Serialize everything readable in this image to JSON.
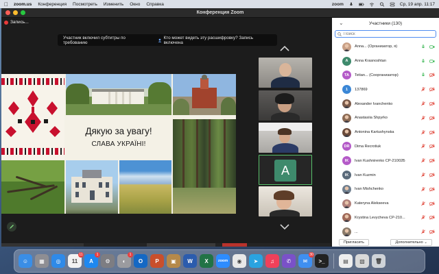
{
  "menubar": {
    "app_name": "zoom.us",
    "menus": [
      "Конференция",
      "Посмотреть",
      "Изменить",
      "Окно",
      "Справка"
    ],
    "status_app": "zoom",
    "datetime": "Ср, 19 апр. 11:17"
  },
  "window": {
    "title": "Конференция Zoom",
    "recording_label": "Запись...",
    "notice_text": "Участник включил субтитры по требованию",
    "notice_link": "Кто может видеть эту расшифровку? Запись включена"
  },
  "slide": {
    "line1": "Дякую за увагу!",
    "line2": "СЛАВА УКРАЇНІ!"
  },
  "video_tiles": [
    {
      "kind": "person"
    },
    {
      "kind": "person"
    },
    {
      "kind": "person"
    },
    {
      "kind": "avatar",
      "letter": "A",
      "color": "#3e8a6c",
      "active": true
    },
    {
      "kind": "person"
    }
  ],
  "participants": {
    "header": "Участники (130)",
    "search_placeholder": "Поиск",
    "rows": [
      {
        "name": "Anna... (Организатор, я)",
        "initials": "",
        "color": "#c9a086",
        "photo": true,
        "mic": "on",
        "video": "on"
      },
      {
        "name": "Anna Krasnoshtan",
        "initials": "A",
        "color": "#3e8a6c",
        "photo": false,
        "mic": "on",
        "video": "on"
      },
      {
        "name": "Tetian... (Соорганизатор)",
        "initials": "TA",
        "color": "#b45ac8",
        "photo": false,
        "mic": "on",
        "video": "off"
      },
      {
        "name": "137869",
        "initials": "1",
        "color": "#3b87d6",
        "photo": false,
        "mic": "off",
        "video": "off"
      },
      {
        "name": "Alexander Ivanchenko",
        "initials": "",
        "color": "#7a5a4a",
        "photo": true,
        "mic": "off",
        "video": "off"
      },
      {
        "name": "Anastasiia Shpyrko",
        "initials": "",
        "color": "#8c6b55",
        "photo": true,
        "mic": "off",
        "video": "off"
      },
      {
        "name": "Antonina Kartushynska",
        "initials": "",
        "color": "#6a4a3a",
        "photo": true,
        "mic": "off",
        "video": "off"
      },
      {
        "name": "Dima Recrotiuk",
        "initials": "DR",
        "color": "#b45ac8",
        "photo": false,
        "mic": "off",
        "video": "off"
      },
      {
        "name": "Ivan Kushnirenko CP-21002Б",
        "initials": "IK",
        "color": "#b45ac8",
        "photo": false,
        "mic": "off",
        "video": "off"
      },
      {
        "name": "Ivan Kuzmin",
        "initials": "IK",
        "color": "#5a6a7a",
        "photo": false,
        "mic": "off",
        "video": "off"
      },
      {
        "name": "Ivan Mishchenko",
        "initials": "",
        "color": "#6f7f8f",
        "photo": true,
        "mic": "off",
        "video": "off"
      },
      {
        "name": "Kateryna Alekseeva",
        "initials": "",
        "color": "#b0807a",
        "photo": true,
        "mic": "off",
        "video": "off"
      },
      {
        "name": "Krystina Levycheva CP-210...",
        "initials": "",
        "color": "#a06a5a",
        "photo": true,
        "mic": "off",
        "video": "off"
      },
      {
        "name": "...",
        "initials": "",
        "color": "#8a7a6a",
        "photo": true,
        "mic": "off",
        "video": "off"
      }
    ],
    "invite_label": "Пригласить",
    "more_label": "Дополнительно"
  },
  "dock": {
    "apps": [
      {
        "name": "finder",
        "color": "#3a8ee6",
        "glyph": "☺",
        "badge": ""
      },
      {
        "name": "launchpad",
        "color": "#8e8e93",
        "glyph": "▦",
        "badge": ""
      },
      {
        "name": "safari",
        "color": "#2f8ae8",
        "glyph": "◎",
        "badge": ""
      },
      {
        "name": "calendar",
        "color": "#f2f2f2",
        "glyph": "11",
        "badge": "11"
      },
      {
        "name": "app-store",
        "color": "#1e88f0",
        "glyph": "A",
        "badge": "1"
      },
      {
        "name": "settings",
        "color": "#7d7d82",
        "glyph": "⚙",
        "badge": ""
      },
      {
        "name": "music-podcasts",
        "color": "#9b9b9f",
        "glyph": "◐",
        "badge": "1"
      },
      {
        "name": "outlook",
        "color": "#1468c4",
        "glyph": "O",
        "badge": ""
      },
      {
        "name": "powerpoint",
        "color": "#c94f2c",
        "glyph": "P",
        "badge": ""
      },
      {
        "name": "archiver",
        "color": "#b5894a",
        "glyph": "▣",
        "badge": ""
      },
      {
        "name": "word",
        "color": "#2b5cad",
        "glyph": "W",
        "badge": ""
      },
      {
        "name": "excel",
        "color": "#217346",
        "glyph": "X",
        "badge": ""
      },
      {
        "name": "zoom",
        "color": "#2d8cff",
        "glyph": "zoom",
        "badge": ""
      },
      {
        "name": "chrome",
        "color": "#e8e8e8",
        "glyph": "◉",
        "badge": ""
      },
      {
        "name": "telegram",
        "color": "#2aa3e0",
        "glyph": "➤",
        "badge": ""
      },
      {
        "name": "music",
        "color": "#f0405a",
        "glyph": "♫",
        "badge": ""
      },
      {
        "name": "viber",
        "color": "#7a51c8",
        "glyph": "✆",
        "badge": ""
      },
      {
        "name": "mail",
        "color": "#3f8ff0",
        "glyph": "✉",
        "badge": "30"
      },
      {
        "name": "terminal",
        "color": "#222222",
        "glyph": ">_",
        "badge": ""
      }
    ],
    "trailing": [
      {
        "name": "document-stack",
        "color": "#eeeeee",
        "glyph": "▤"
      },
      {
        "name": "image-stack",
        "color": "#d9d9d9",
        "glyph": "▧"
      },
      {
        "name": "trash",
        "color": "#cfd3d8",
        "glyph": "🗑"
      }
    ]
  }
}
